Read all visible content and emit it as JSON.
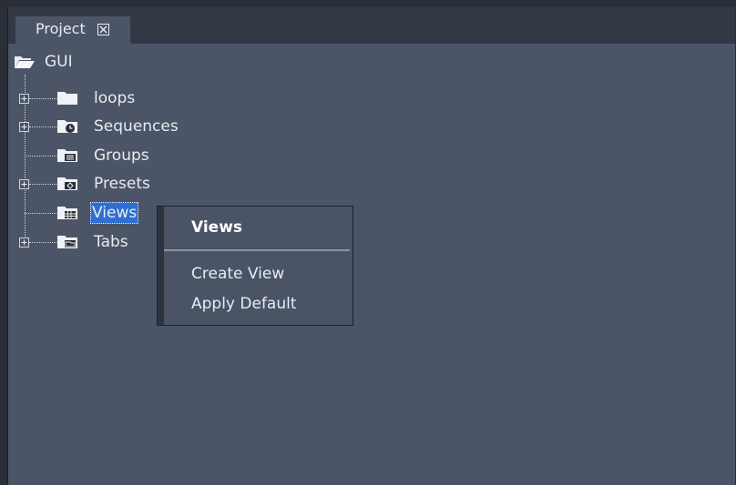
{
  "panel": {
    "tab_label": "Project"
  },
  "tree": {
    "root": {
      "label": "GUI",
      "icon": "folder-open-icon"
    },
    "items": [
      {
        "label": "loops",
        "icon": "folder-icon",
        "expandable": true
      },
      {
        "label": "Sequences",
        "icon": "folder-sequence-icon",
        "expandable": true
      },
      {
        "label": "Groups",
        "icon": "folder-groups-icon",
        "expandable": false
      },
      {
        "label": "Presets",
        "icon": "folder-presets-icon",
        "expandable": true
      },
      {
        "label": "Views",
        "icon": "folder-views-icon",
        "expandable": false,
        "selected": true
      },
      {
        "label": "Tabs",
        "icon": "folder-tabs-icon",
        "expandable": true
      }
    ]
  },
  "context_menu": {
    "title": "Views",
    "items": [
      "Create View",
      "Apply Default"
    ]
  },
  "colors": {
    "panel_bg": "#4b5567",
    "tabbar_bg": "#323945",
    "selection": "#2f6fd1",
    "text": "#e8ecf1"
  }
}
